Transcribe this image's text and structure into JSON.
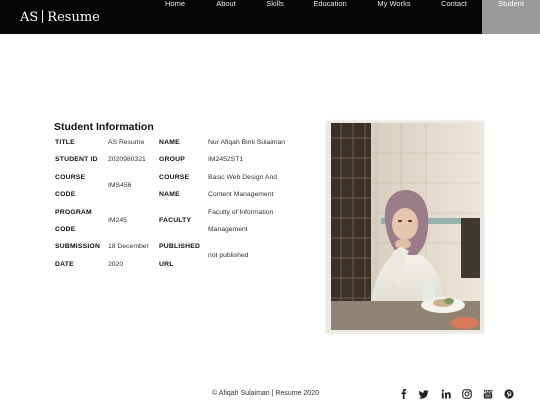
{
  "brand": {
    "left": "AS",
    "right": "Resume"
  },
  "nav": {
    "items": [
      {
        "label": "Home"
      },
      {
        "label": "About"
      },
      {
        "label": "Skills"
      },
      {
        "label": "Education"
      },
      {
        "label": "My Works"
      },
      {
        "label": "Contact"
      },
      {
        "label": "Student"
      }
    ],
    "active": "Student"
  },
  "info": {
    "title": "Student Information",
    "rows": {
      "title_label": "TITLE",
      "title_value": "AS Resume",
      "name_label": "NAME",
      "name_value": "Nur Afiqah Binti Sulaiman",
      "student_id_label": "STUDENT ID",
      "student_id_value": "2020980321",
      "group_label": "GROUP",
      "group_value": "IM2452ST1",
      "course_code_label_1": "COURSE",
      "course_code_label_2": "CODE",
      "course_code_value": "IMS456",
      "course_name_label_1": "COURSE",
      "course_name_label_2": "NAME",
      "course_name_value_1": "Basic Web Design And",
      "course_name_value_2": "Content Management",
      "program_code_label_1": "PROGRAM",
      "program_code_label_2": "CODE",
      "program_code_value": "IM245",
      "faculty_label": "FACULTY",
      "faculty_value_1": "Faculty of Information",
      "faculty_value_2": "Management",
      "submission_label_1": "SUBMISSION",
      "submission_label_2": "DATE",
      "submission_value_1": "18 December",
      "submission_value_2": "2020",
      "published_label_1": "PUBLISHED",
      "published_label_2": "URL",
      "published_value": "not published"
    }
  },
  "footer": {
    "copyright": "© Afiqah Sulaiman | Resume 2020",
    "social_icons": [
      "facebook-icon",
      "twitter-icon",
      "linkedin-icon",
      "instagram-icon",
      "youtube-icon",
      "pinterest-icon"
    ]
  },
  "colors": {
    "navbar_bg": "#050505",
    "active_nav_bg": "#9a9a9a",
    "page_bg": "#ffffff"
  }
}
